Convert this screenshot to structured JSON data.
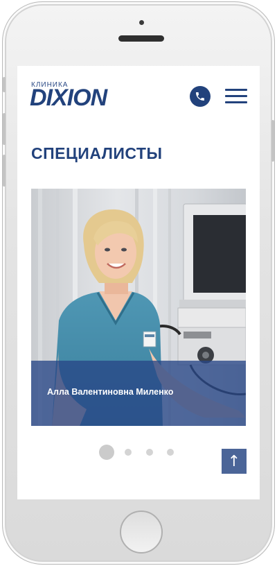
{
  "header": {
    "logo_small": "КЛИНИКА",
    "logo_big": "DIXION",
    "phone_icon": "phone-icon",
    "menu_icon": "hamburger-menu-icon"
  },
  "page": {
    "title": "СПЕЦИАЛИСТЫ"
  },
  "slider": {
    "current_specialist": "Алла Валентиновна Миленко",
    "slides_count": 4,
    "active_index": 0
  },
  "controls": {
    "scroll_top_label": "↑",
    "scroll_top_icon": "arrow-up-icon"
  },
  "colors": {
    "brand": "#22427c",
    "overlay": "#284687",
    "scroll_button": "#4b6598"
  }
}
